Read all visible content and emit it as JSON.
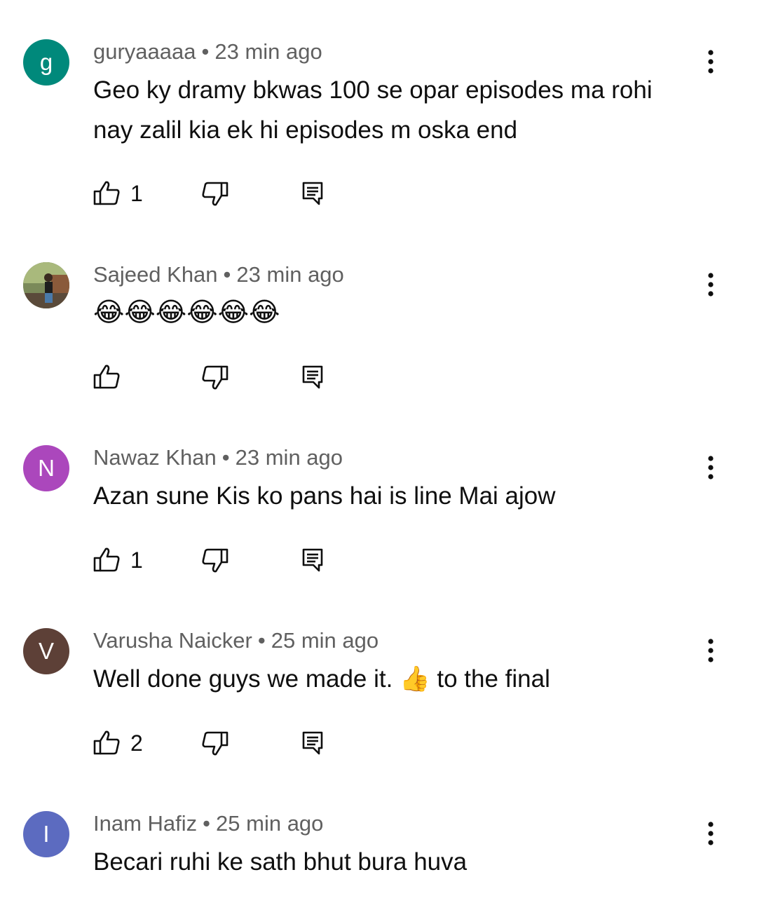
{
  "comments": [
    {
      "author": "guryaaaaa",
      "time": "23 min ago",
      "text": "Geo ky dramy bkwas 100 se opar episodes ma rohi nay zalil kia ek hi episodes m oska end",
      "avatar_letter": "g",
      "avatar_color": "#00897b",
      "likes": "1"
    },
    {
      "author": "Sajeed Khan",
      "time": "23 min ago",
      "text": "😂😂😂😂😂😂",
      "avatar_letter": "",
      "avatar_color": "#5d6d4c",
      "likes": ""
    },
    {
      "author": "Nawaz Khan",
      "time": "23 min ago",
      "text": "Azan sune Kis ko pans hai is line Mai ajow",
      "avatar_letter": "N",
      "avatar_color": "#ab47bc",
      "likes": "1"
    },
    {
      "author": "Varusha Naicker",
      "time": "25 min ago",
      "text": "Well done guys we made it. 👍 to the final",
      "avatar_letter": "V",
      "avatar_color": "#5d4037",
      "likes": "2"
    },
    {
      "author": "Inam Hafiz",
      "time": "25 min ago",
      "text": "Becari ruhi ke sath bhut bura huva",
      "avatar_letter": "I",
      "avatar_color": "#5c6bc0",
      "likes": ""
    }
  ],
  "separator": "•",
  "icons": {
    "like": "thumbs-up-icon",
    "dislike": "thumbs-down-icon",
    "reply": "reply-comment-icon",
    "more": "more-vertical-icon"
  }
}
